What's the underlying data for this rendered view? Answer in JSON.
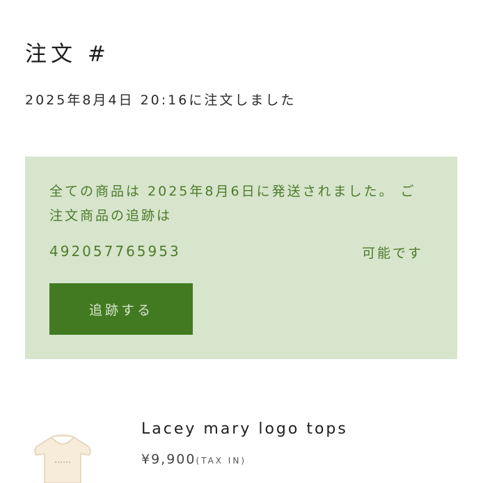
{
  "order": {
    "title": "注文 #",
    "date_text": "2025年8月4日  20:16に注文しました"
  },
  "shipping_notice": {
    "message": "全ての商品は 2025年8月6日に発送されました。 ご注文商品の追跡は",
    "tracking_number": "492057765953",
    "message_tail": "可能です",
    "track_button_label": "追跡する"
  },
  "product": {
    "name": "Lacey mary logo tops",
    "price": "¥9,900",
    "tax_note": "(TAX IN)",
    "thumbnail_icon": "cream-top-garment-image"
  },
  "colors": {
    "notice_background": "#d6e5cc",
    "notice_text": "#4f7a2b",
    "button_background": "#427a21",
    "button_text": "#d6e5cc"
  }
}
